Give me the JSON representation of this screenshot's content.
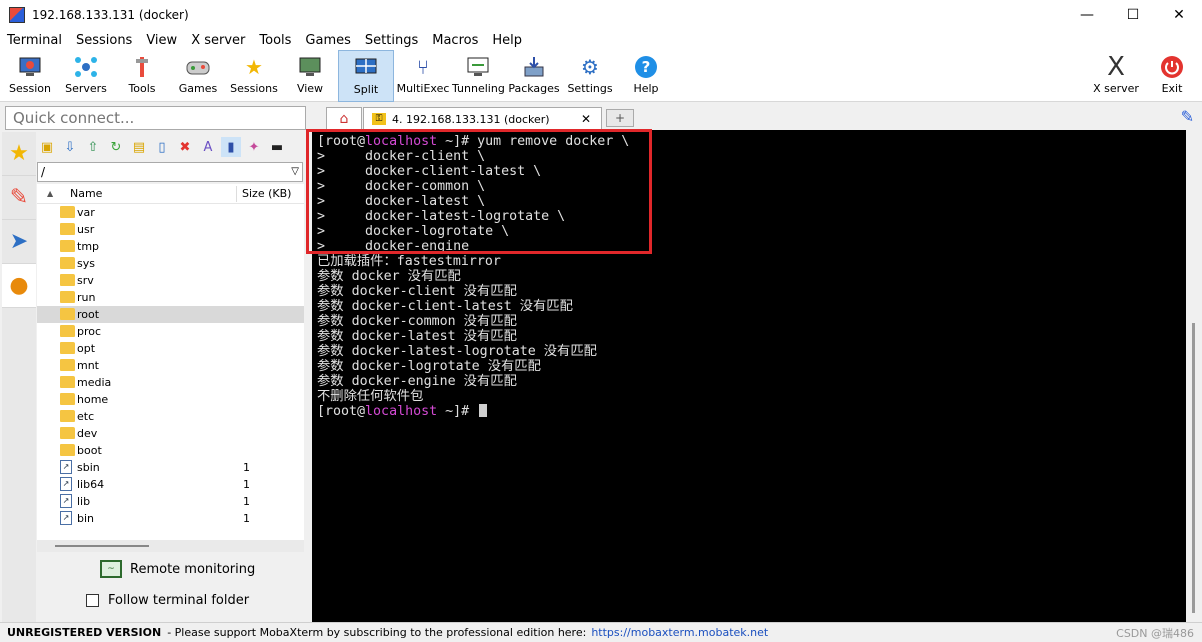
{
  "window": {
    "title": "192.168.133.131 (docker)",
    "minimize": "—",
    "maximize": "☐",
    "close": "✕"
  },
  "menu": [
    "Terminal",
    "Sessions",
    "View",
    "X server",
    "Tools",
    "Games",
    "Settings",
    "Macros",
    "Help"
  ],
  "toolbar": {
    "session": "Session",
    "servers": "Servers",
    "tools": "Tools",
    "games": "Games",
    "sessions": "Sessions",
    "view": "View",
    "split": "Split",
    "multiexec": "MultiExec",
    "tunneling": "Tunneling",
    "packages": "Packages",
    "settings": "Settings",
    "help": "Help",
    "xserver": "X server",
    "exit": "Exit"
  },
  "sidebar": {
    "quick_connect_placeholder": "Quick connect...",
    "path": "/",
    "columns": {
      "name": "Name",
      "size": "Size (KB)"
    },
    "files": [
      {
        "name": "var",
        "type": "folder",
        "size": ""
      },
      {
        "name": "usr",
        "type": "folder",
        "size": ""
      },
      {
        "name": "tmp",
        "type": "folder",
        "size": ""
      },
      {
        "name": "sys",
        "type": "folder",
        "size": ""
      },
      {
        "name": "srv",
        "type": "folder",
        "size": ""
      },
      {
        "name": "run",
        "type": "folder",
        "size": ""
      },
      {
        "name": "root",
        "type": "folder",
        "size": "",
        "selected": true
      },
      {
        "name": "proc",
        "type": "folder",
        "size": ""
      },
      {
        "name": "opt",
        "type": "folder",
        "size": ""
      },
      {
        "name": "mnt",
        "type": "folder",
        "size": ""
      },
      {
        "name": "media",
        "type": "folder",
        "size": ""
      },
      {
        "name": "home",
        "type": "folder",
        "size": ""
      },
      {
        "name": "etc",
        "type": "folder",
        "size": ""
      },
      {
        "name": "dev",
        "type": "folder",
        "size": ""
      },
      {
        "name": "boot",
        "type": "folder",
        "size": ""
      },
      {
        "name": "sbin",
        "type": "link",
        "size": "1"
      },
      {
        "name": "lib64",
        "type": "link",
        "size": "1"
      },
      {
        "name": "lib",
        "type": "link",
        "size": "1"
      },
      {
        "name": "bin",
        "type": "link",
        "size": "1"
      }
    ],
    "remote_monitoring": "Remote monitoring",
    "follow_terminal_folder": "Follow terminal folder"
  },
  "tabs": {
    "session_tab": "4. 192.168.133.131 (docker)",
    "close": "✕"
  },
  "terminal": {
    "lines": [
      {
        "pre": "[root@",
        "host": "localhost",
        "post": " ~]# yum remove docker \\"
      },
      {
        "text": ">     docker-client \\"
      },
      {
        "text": ">     docker-client-latest \\"
      },
      {
        "text": ">     docker-common \\"
      },
      {
        "text": ">     docker-latest \\"
      },
      {
        "text": ">     docker-latest-logrotate \\"
      },
      {
        "text": ">     docker-logrotate \\"
      },
      {
        "text": ">     docker-engine"
      },
      {
        "text": "已加载插件：fastestmirror"
      },
      {
        "text": "参数 docker 没有匹配"
      },
      {
        "text": "参数 docker-client 没有匹配"
      },
      {
        "text": "参数 docker-client-latest 没有匹配"
      },
      {
        "text": "参数 docker-common 没有匹配"
      },
      {
        "text": "参数 docker-latest 没有匹配"
      },
      {
        "text": "参数 docker-latest-logrotate 没有匹配"
      },
      {
        "text": "参数 docker-logrotate 没有匹配"
      },
      {
        "text": "参数 docker-engine 没有匹配"
      },
      {
        "text": "不删除任何软件包"
      },
      {
        "pre": "[root@",
        "host": "localhost",
        "post": " ~]# ",
        "cursor": true
      }
    ]
  },
  "status": {
    "unregistered": "UNREGISTERED VERSION",
    "message": "-  Please support MobaXterm by subscribing to the professional edition here:",
    "link": "https://mobaxterm.mobatek.net",
    "watermark": "CSDN @瑞486"
  }
}
